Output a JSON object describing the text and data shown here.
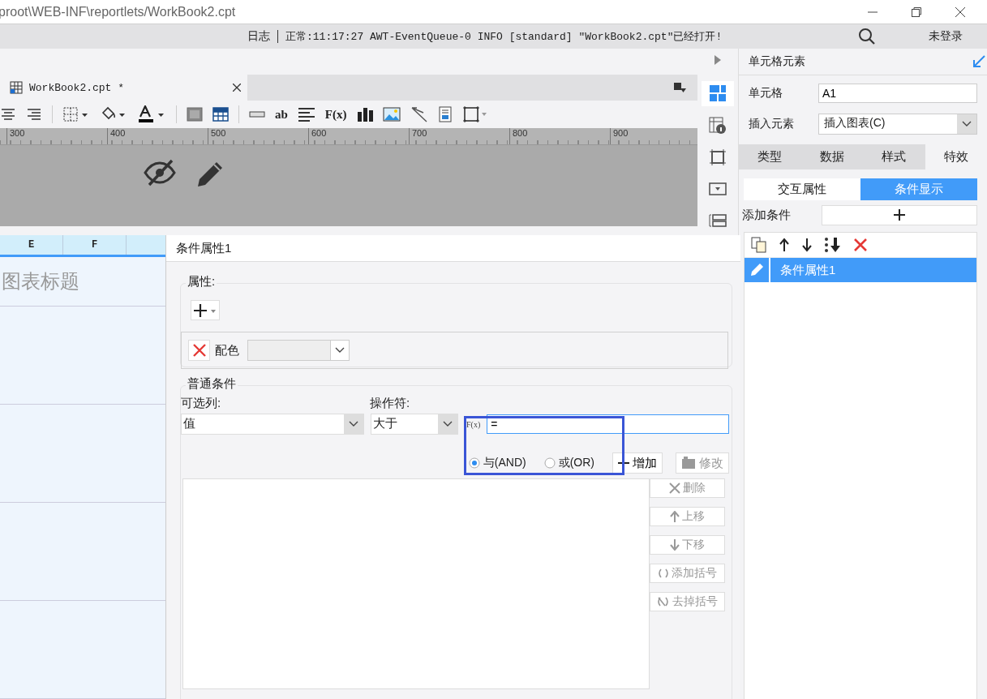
{
  "window": {
    "title": "proot\\WEB-INF\\reportlets/WorkBook2.cpt"
  },
  "log_bar": {
    "label": "日志",
    "message": "正常:11:17:27 AWT-EventQueue-0 INFO [standard] \"WorkBook2.cpt\"已经打开!",
    "login": "未登录"
  },
  "tabs": [
    {
      "label": "WorkBook2.cpt *",
      "selected": true
    }
  ],
  "toolbar": [
    {
      "kind": "align-center"
    },
    {
      "kind": "align-right"
    },
    {
      "kind": "sep"
    },
    {
      "kind": "border"
    },
    {
      "kind": "fill"
    },
    {
      "kind": "font-color"
    },
    {
      "kind": "sep"
    },
    {
      "kind": "merge"
    },
    {
      "kind": "grid"
    },
    {
      "kind": "sep"
    },
    {
      "kind": "field"
    },
    {
      "kind": "text",
      "label": "ab"
    },
    {
      "kind": "lines"
    },
    {
      "kind": "text",
      "label": "F(x)"
    },
    {
      "kind": "chart"
    },
    {
      "kind": "image"
    },
    {
      "kind": "slash"
    },
    {
      "kind": "doc"
    },
    {
      "kind": "frame"
    }
  ],
  "ruler": [
    "300",
    "400",
    "500",
    "600",
    "700",
    "800",
    "900"
  ],
  "sheet": {
    "columns": [
      "E",
      "F"
    ],
    "title_cell": "图表标题"
  },
  "condition": {
    "header": "条件属性1",
    "properties": {
      "legend": "属性:",
      "color_label": "配色"
    },
    "common": {
      "legend": "普通条件",
      "column_label": "可选列:",
      "column_value": "值",
      "operator_label": "操作符:",
      "operator_value": "大于",
      "formula_button": "F(x)",
      "formula_value": "=",
      "logic": [
        {
          "label": "与(AND)",
          "selected": true
        },
        {
          "label": "或(OR)",
          "selected": false
        }
      ],
      "add_button": "增加",
      "edit_button": {
        "label": "修改",
        "disabled": true
      },
      "side_buttons": [
        {
          "kind": "delete",
          "label": "删除",
          "disabled": true
        },
        {
          "kind": "up",
          "label": "上移",
          "disabled": true
        },
        {
          "kind": "down",
          "label": "下移",
          "disabled": true
        },
        {
          "kind": "paren",
          "label": "添加括号",
          "disabled": true
        },
        {
          "kind": "unparen",
          "label": "去掉括号",
          "disabled": true
        }
      ]
    }
  },
  "side_icons": [
    {
      "kind": "cell",
      "selected": true
    },
    {
      "kind": "info",
      "selected": false
    },
    {
      "kind": "frame",
      "selected": false
    },
    {
      "kind": "widget",
      "selected": false
    },
    {
      "kind": "stack",
      "selected": false
    }
  ],
  "panel": {
    "title": "单元格元素",
    "cell_label": "单元格",
    "cell_value": "A1",
    "insert_label": "插入元素",
    "insert_value": "插入图表(C)",
    "tabs": [
      {
        "label": "类型",
        "selected": false
      },
      {
        "label": "数据",
        "selected": false
      },
      {
        "label": "样式",
        "selected": false
      },
      {
        "label": "特效",
        "selected": true
      }
    ],
    "subtabs": [
      {
        "label": "交互属性",
        "selected": false
      },
      {
        "label": "条件显示",
        "selected": true
      }
    ],
    "add_label": "添加条件",
    "items": [
      {
        "label": "条件属性1",
        "selected": true
      }
    ]
  }
}
